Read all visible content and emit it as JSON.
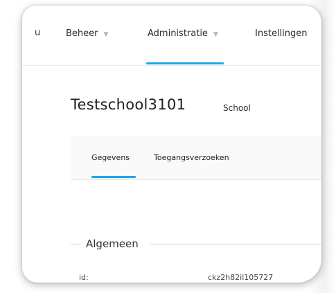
{
  "topnav": {
    "edge_glyph": "u",
    "items": [
      {
        "label": "Beheer",
        "has_dropdown": true
      },
      {
        "label": "Administratie",
        "has_dropdown": true,
        "active": true
      },
      {
        "label": "Instellingen",
        "has_dropdown": false
      }
    ],
    "chevron_glyph": "▼"
  },
  "page": {
    "title": "Testschool3101",
    "subtitle": "School"
  },
  "tabs": [
    {
      "label": "Gegevens",
      "active": true
    },
    {
      "label": "Toegangsverzoeken",
      "active": false
    }
  ],
  "section": {
    "legend": "Algemeen",
    "fields": [
      {
        "label": "id:",
        "value": "ckz2h82il105727"
      }
    ]
  },
  "colors": {
    "accent": "#21a6e8",
    "text": "#2b2b2b",
    "tab_panel_bg": "#f9f9f9"
  }
}
